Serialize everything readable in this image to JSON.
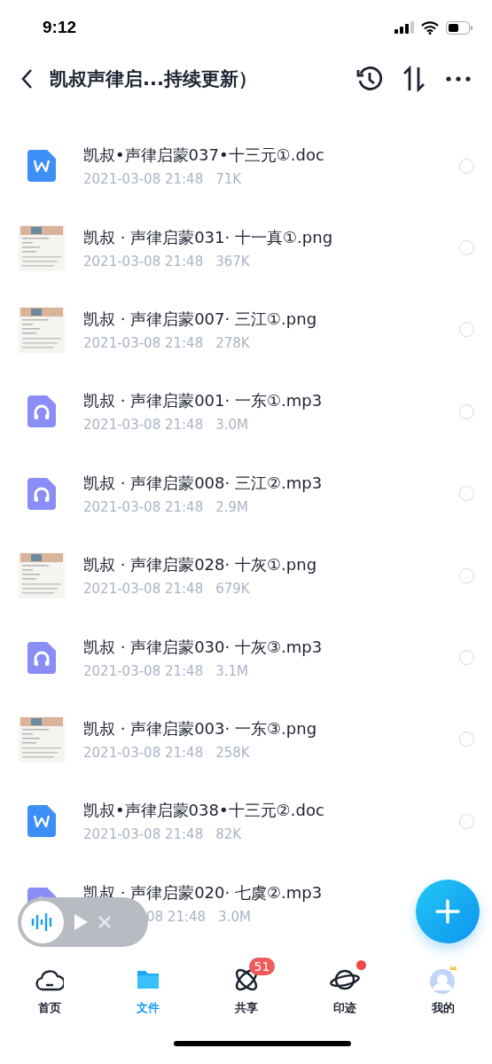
{
  "status_bar": {
    "time": "9:12"
  },
  "nav": {
    "title": "凯叔声律启...持续更新）"
  },
  "files": [
    {
      "kind": "doc",
      "name": "凯叔•声律启蒙037•十三元①.doc",
      "date": "2021-03-08 21:48",
      "size": "71K",
      "checked": false
    },
    {
      "name": "凯叔 · 声律启蒙031· 十一真①.png",
      "date": "2021-03-08 21:48",
      "size": "367K",
      "checked": false
    },
    {
      "name": "凯叔 · 声律启蒙007· 三江①.png",
      "date": "2021-03-08 21:48",
      "size": "278K",
      "checked": false
    },
    {
      "kind": "audio",
      "name": "凯叔 · 声律启蒙001· 一东①.mp3",
      "date": "2021-03-08 21:48",
      "size": "3.0M",
      "checked": false
    },
    {
      "kind": "audio",
      "name": "凯叔 · 声律启蒙008· 三江②.mp3",
      "date": "2021-03-08 21:48",
      "size": "2.9M",
      "checked": false
    },
    {
      "name": "凯叔 · 声律启蒙028· 十灰①.png",
      "date": "2021-03-08 21:48",
      "size": "679K",
      "checked": false
    },
    {
      "kind": "audio",
      "name": "凯叔 · 声律启蒙030· 十灰③.mp3",
      "date": "2021-03-08 21:48",
      "size": "3.1M",
      "checked": false
    },
    {
      "name": "凯叔 · 声律启蒙003· 一东③.png",
      "date": "2021-03-08 21:48",
      "size": "258K",
      "checked": false
    },
    {
      "kind": "doc",
      "name": "凯叔•声律启蒙038•十三元②.doc",
      "date": "2021-03-08 21:48",
      "size": "82K",
      "checked": false
    },
    {
      "kind": "audio",
      "name": "凯叔 · 声律启蒙020· 七虞②.mp3",
      "date": "08 21:48",
      "size": "3.0M",
      "covered": true
    }
  ],
  "tabs": [
    {
      "kind": "home",
      "label": "首页",
      "selected": false
    },
    {
      "kind": "files",
      "label": "文件",
      "selected": true
    },
    {
      "kind": "share",
      "label": "共享",
      "selected": false,
      "badge": "51"
    },
    {
      "kind": "trace",
      "label": "印迹",
      "selected": false,
      "dot": true
    },
    {
      "kind": "me",
      "label": "我的",
      "selected": false
    }
  ]
}
